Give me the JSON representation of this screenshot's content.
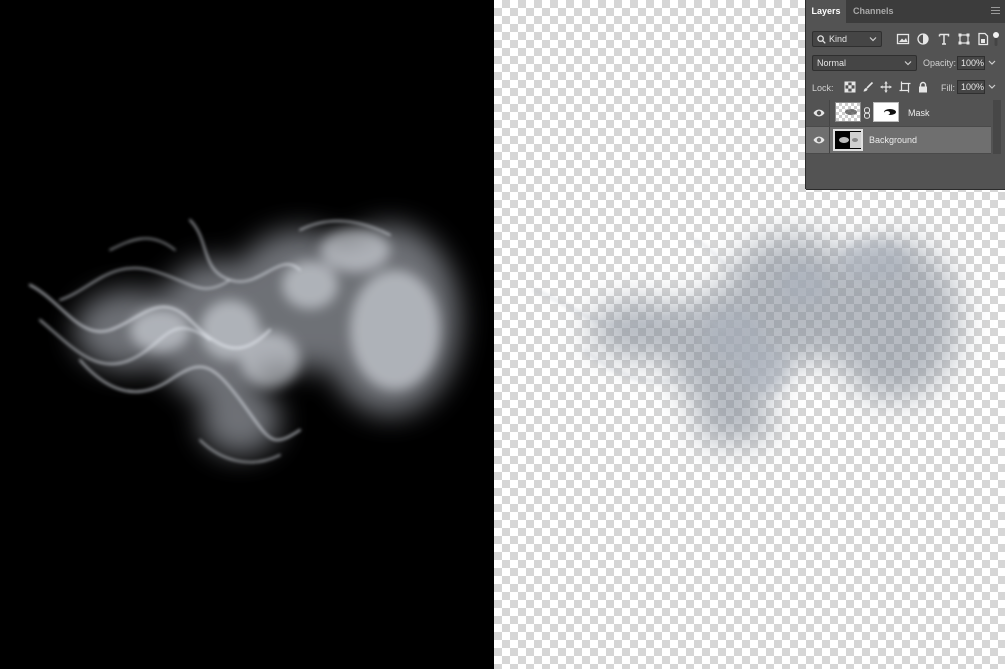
{
  "panel": {
    "tabs": [
      {
        "label": "Layers",
        "active": true
      },
      {
        "label": "Channels",
        "active": false
      }
    ],
    "filter": {
      "kind_label": "Kind",
      "icons": [
        "pixel-layer-filter-icon",
        "adjustment-layer-filter-icon",
        "type-layer-filter-icon",
        "shape-layer-filter-icon",
        "smart-object-filter-icon"
      ]
    },
    "blend_mode": "Normal",
    "opacity_label": "Opacity:",
    "opacity_value": "100%",
    "lock_label": "Lock:",
    "lock_icons": [
      "lock-transparent-pixels-icon",
      "lock-image-pixels-icon",
      "lock-position-icon",
      "lock-artboard-icon",
      "lock-all-icon"
    ],
    "fill_label": "Fill:",
    "fill_value": "100%",
    "layers": [
      {
        "name": "Mask",
        "visible": true,
        "has_mask": true,
        "selected": false
      },
      {
        "name": "Background",
        "visible": true,
        "has_mask": false,
        "selected": true
      }
    ]
  },
  "colors": {
    "panel_bg": "#535353",
    "tabbar_bg": "#3c3c3c",
    "selected_row": "#6f6f6f",
    "left_canvas": "#000000",
    "smoke_on_black": "#dfe3ea",
    "smoke_on_transparent": "#9aa1ac"
  }
}
